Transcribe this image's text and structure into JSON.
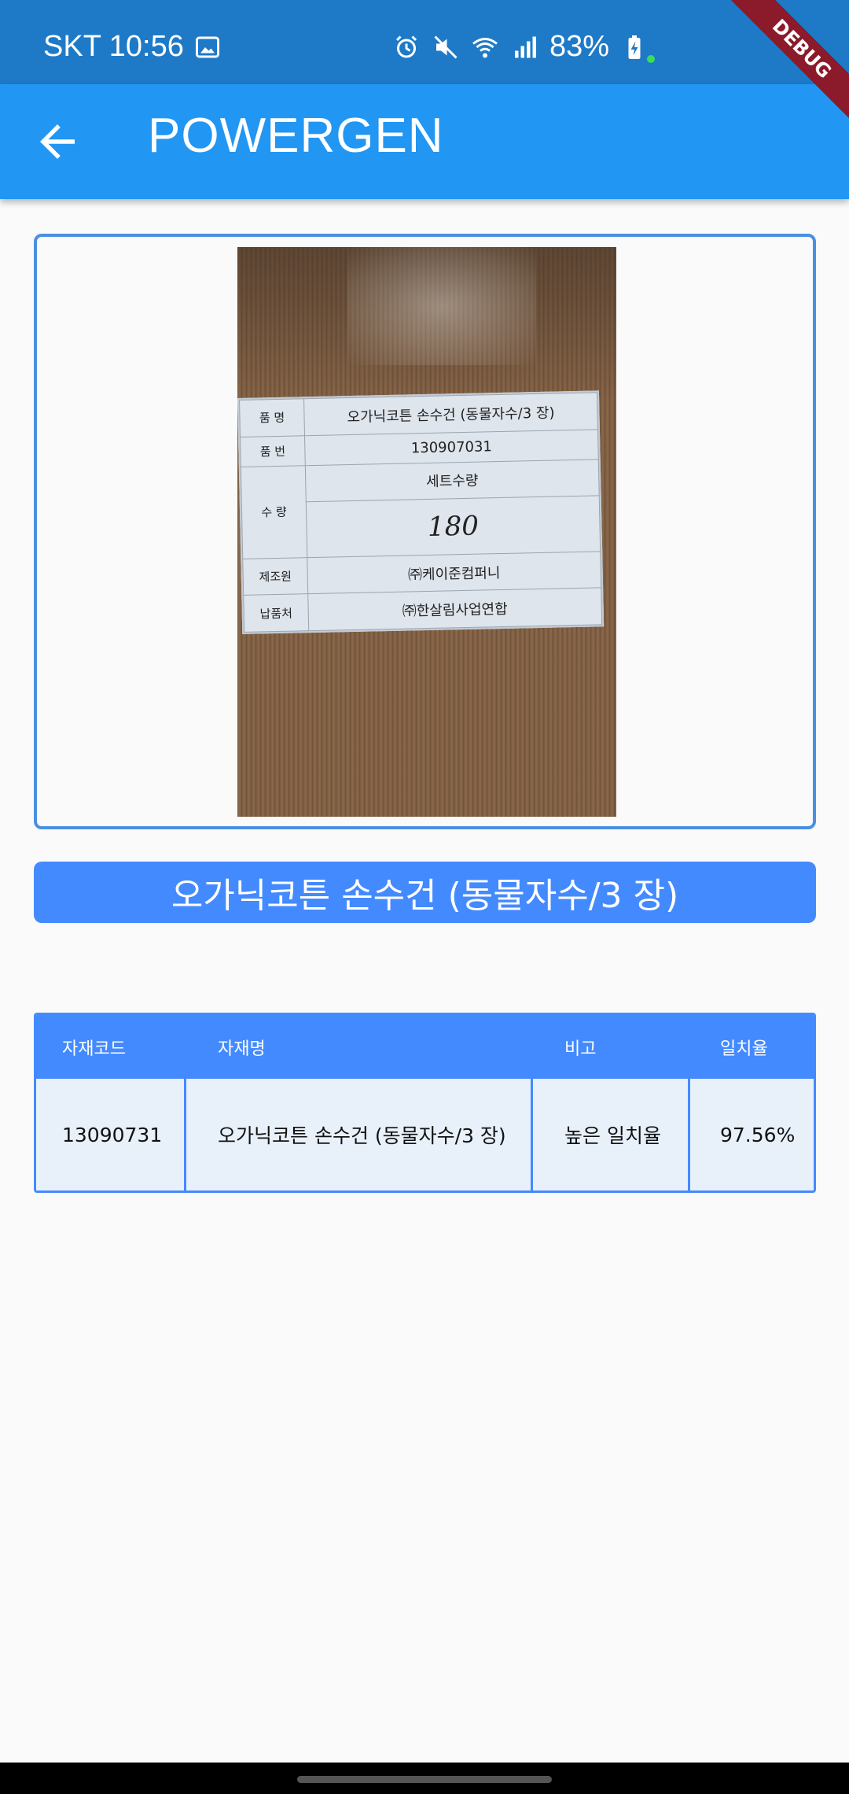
{
  "status_bar": {
    "carrier_time": "SKT 10:56",
    "battery": "83%",
    "icons": [
      "image-icon",
      "alarm-icon",
      "mute-icon",
      "wifi-icon",
      "signal-icon",
      "battery-charging-icon"
    ]
  },
  "app_bar": {
    "title": "POWERGEN",
    "back_icon": "arrow-back-icon"
  },
  "debug_banner": "DEBUG",
  "photo": {
    "label_rows": [
      {
        "key": "품 명",
        "value": "오가닉코튼 손수건 (동물자수/3 장)"
      },
      {
        "key": "품 번",
        "value": "130907031"
      },
      {
        "key": "수 량",
        "value": "세트수량"
      },
      {
        "key": "",
        "value": "180"
      },
      {
        "key": "제조원",
        "value": "㈜케이준컴퍼니"
      },
      {
        "key": "납품처",
        "value": "㈜한살림사업연합"
      }
    ]
  },
  "product_name": "오가닉코튼 손수건 (동물자수/3 장)",
  "table": {
    "headers": [
      "자재코드",
      "자재명",
      "비고",
      "일치율"
    ],
    "rows": [
      [
        "13090731",
        "오가닉코튼 손수건 (동물자수/3 장)",
        "높은 일치율",
        "97.56%"
      ]
    ]
  },
  "colors": {
    "status_bar": "#1e7ac7",
    "app_bar": "#2196f3",
    "accent": "#448aff",
    "row_bg": "#e8f0fa"
  }
}
